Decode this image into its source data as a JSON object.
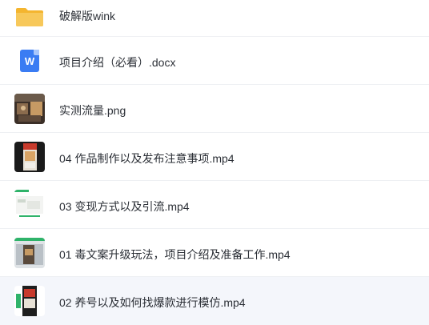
{
  "files": [
    {
      "name": "破解版wink",
      "type": "folder",
      "icon": "folder-icon"
    },
    {
      "name": "项目介绍（必看）.docx",
      "type": "docx",
      "icon": "word-doc-icon",
      "icon_letter": "W"
    },
    {
      "name": "实测流量.png",
      "type": "png",
      "icon": "image-thumbnail"
    },
    {
      "name": "04 作品制作以及发布注意事项.mp4",
      "type": "mp4",
      "icon": "video-thumbnail"
    },
    {
      "name": "03 变现方式以及引流.mp4",
      "type": "mp4",
      "icon": "video-thumbnail"
    },
    {
      "name": "01 毒文案升级玩法，项目介绍及准备工作.mp4",
      "type": "mp4",
      "icon": "video-thumbnail"
    },
    {
      "name": "02 养号以及如何找爆款进行模仿.mp4",
      "type": "mp4",
      "icon": "video-thumbnail",
      "selected": true
    }
  ],
  "colors": {
    "folder": "#f7c244",
    "word": "#3a7cf3",
    "selected_row": "#f4f6fb",
    "text": "#2b2f36"
  }
}
